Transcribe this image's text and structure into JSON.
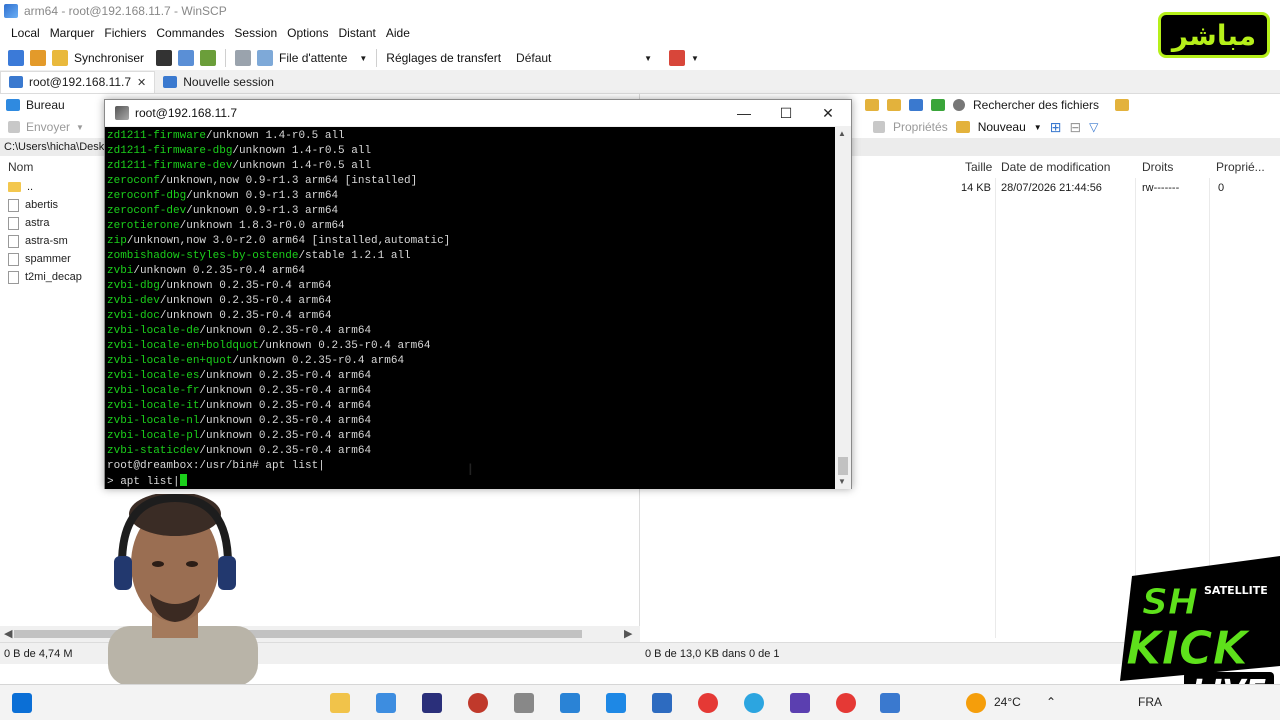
{
  "window": {
    "title": "arm64 - root@192.168.11.7 - WinSCP"
  },
  "menu": [
    "Local",
    "Marquer",
    "Fichiers",
    "Commandes",
    "Session",
    "Options",
    "Distant",
    "Aide"
  ],
  "toolbar": {
    "sync_label": "Synchroniser",
    "queue_label": "File d'attente",
    "transfer_label": "Réglages de transfert",
    "transfer_value": "Défaut"
  },
  "tabs": {
    "session": "root@192.168.11.7",
    "new_session": "Nouvelle session"
  },
  "left_panel": {
    "drive": "Bureau",
    "send_label": "Envoyer",
    "path": "C:\\Users\\hicha\\Desk",
    "col_name": "Nom",
    "items": [
      "..",
      "abertis",
      "astra",
      "astra-sm",
      "spammer",
      "t2mi_decap"
    ]
  },
  "right_panel": {
    "find_label": "Rechercher des fichiers",
    "props_label": "Propriétés",
    "new_label": "Nouveau",
    "cols": {
      "size": "Taille",
      "modified": "Date de modification",
      "rights": "Droits",
      "owner": "Proprié..."
    },
    "rows": [
      {
        "size": "14 KB",
        "modified": "28/07/2026 21:44:56",
        "rights": "rw-------",
        "owner": "0"
      }
    ]
  },
  "status": {
    "left": "0 B de 4,74 M",
    "right": "0 B de 13,0 KB dans 0 de 1"
  },
  "terminal": {
    "title": "root@192.168.11.7",
    "lines": [
      {
        "pkg": "zd1211-firmware",
        "rest": "/unknown 1.4-r0.5 all"
      },
      {
        "pkg": "zd1211-firmware-dbg",
        "rest": "/unknown 1.4-r0.5 all"
      },
      {
        "pkg": "zd1211-firmware-dev",
        "rest": "/unknown 1.4-r0.5 all"
      },
      {
        "pkg": "zeroconf",
        "rest": "/unknown,now 0.9-r1.3 arm64 [installed]"
      },
      {
        "pkg": "zeroconf-dbg",
        "rest": "/unknown 0.9-r1.3 arm64"
      },
      {
        "pkg": "zeroconf-dev",
        "rest": "/unknown 0.9-r1.3 arm64"
      },
      {
        "pkg": "zerotierone",
        "rest": "/unknown 1.8.3-r0.0 arm64"
      },
      {
        "pkg": "zip",
        "rest": "/unknown,now 3.0-r2.0 arm64 [installed,automatic]"
      },
      {
        "pkg": "zombishadow-styles-by-ostende",
        "rest": "/stable 1.2.1 all"
      },
      {
        "pkg": "zvbi",
        "rest": "/unknown 0.2.35-r0.4 arm64"
      },
      {
        "pkg": "zvbi-dbg",
        "rest": "/unknown 0.2.35-r0.4 arm64"
      },
      {
        "pkg": "zvbi-dev",
        "rest": "/unknown 0.2.35-r0.4 arm64"
      },
      {
        "pkg": "zvbi-doc",
        "rest": "/unknown 0.2.35-r0.4 arm64"
      },
      {
        "pkg": "zvbi-locale-de",
        "rest": "/unknown 0.2.35-r0.4 arm64"
      },
      {
        "pkg": "zvbi-locale-en+boldquot",
        "rest": "/unknown 0.2.35-r0.4 arm64"
      },
      {
        "pkg": "zvbi-locale-en+quot",
        "rest": "/unknown 0.2.35-r0.4 arm64"
      },
      {
        "pkg": "zvbi-locale-es",
        "rest": "/unknown 0.2.35-r0.4 arm64"
      },
      {
        "pkg": "zvbi-locale-fr",
        "rest": "/unknown 0.2.35-r0.4 arm64"
      },
      {
        "pkg": "zvbi-locale-it",
        "rest": "/unknown 0.2.35-r0.4 arm64"
      },
      {
        "pkg": "zvbi-locale-nl",
        "rest": "/unknown 0.2.35-r0.4 arm64"
      },
      {
        "pkg": "zvbi-locale-pl",
        "rest": "/unknown 0.2.35-r0.4 arm64"
      },
      {
        "pkg": "zvbi-staticdev",
        "rest": "/unknown 0.2.35-r0.4 arm64"
      }
    ],
    "prompt": "root@dreambox:/usr/bin# apt list|",
    "continuation": "> apt list|"
  },
  "taskbar": {
    "weather": "24°C",
    "lang": "FRA"
  },
  "overlays": {
    "channel_logo": "مباشر",
    "kick_brand": "SH SATELLITE KICK LIVE"
  },
  "colors": {
    "terminal_green": "#1bd01b",
    "logo_green": "#b6f01a"
  }
}
